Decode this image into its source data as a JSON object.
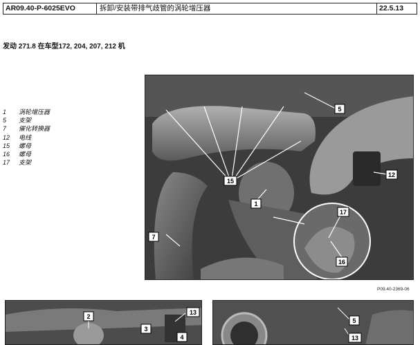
{
  "header": {
    "doc_code": "AR09.40-P-6025EVO",
    "title": "拆卸/安装带排气歧管的涡轮增压器",
    "date": "22.5.13"
  },
  "engine_line": "发动  271.8 在车型172, 204, 207, 212 机",
  "legend": [
    {
      "num": "1",
      "label": "涡轮增压器"
    },
    {
      "num": "5",
      "label": "支架"
    },
    {
      "num": "7",
      "label": "催化转换器"
    },
    {
      "num": "12",
      "label": "电线"
    },
    {
      "num": "15",
      "label": "螺母"
    },
    {
      "num": "16",
      "label": "螺母"
    },
    {
      "num": "17",
      "label": "支架"
    }
  ],
  "figure_id": "P09.40-2369-06",
  "main_callouts": [
    "5",
    "12",
    "15",
    "1",
    "7",
    "17",
    "16"
  ],
  "thumb_left_callouts": [
    "2",
    "13",
    "3",
    "4"
  ],
  "thumb_right_callouts": [
    "5",
    "13"
  ]
}
